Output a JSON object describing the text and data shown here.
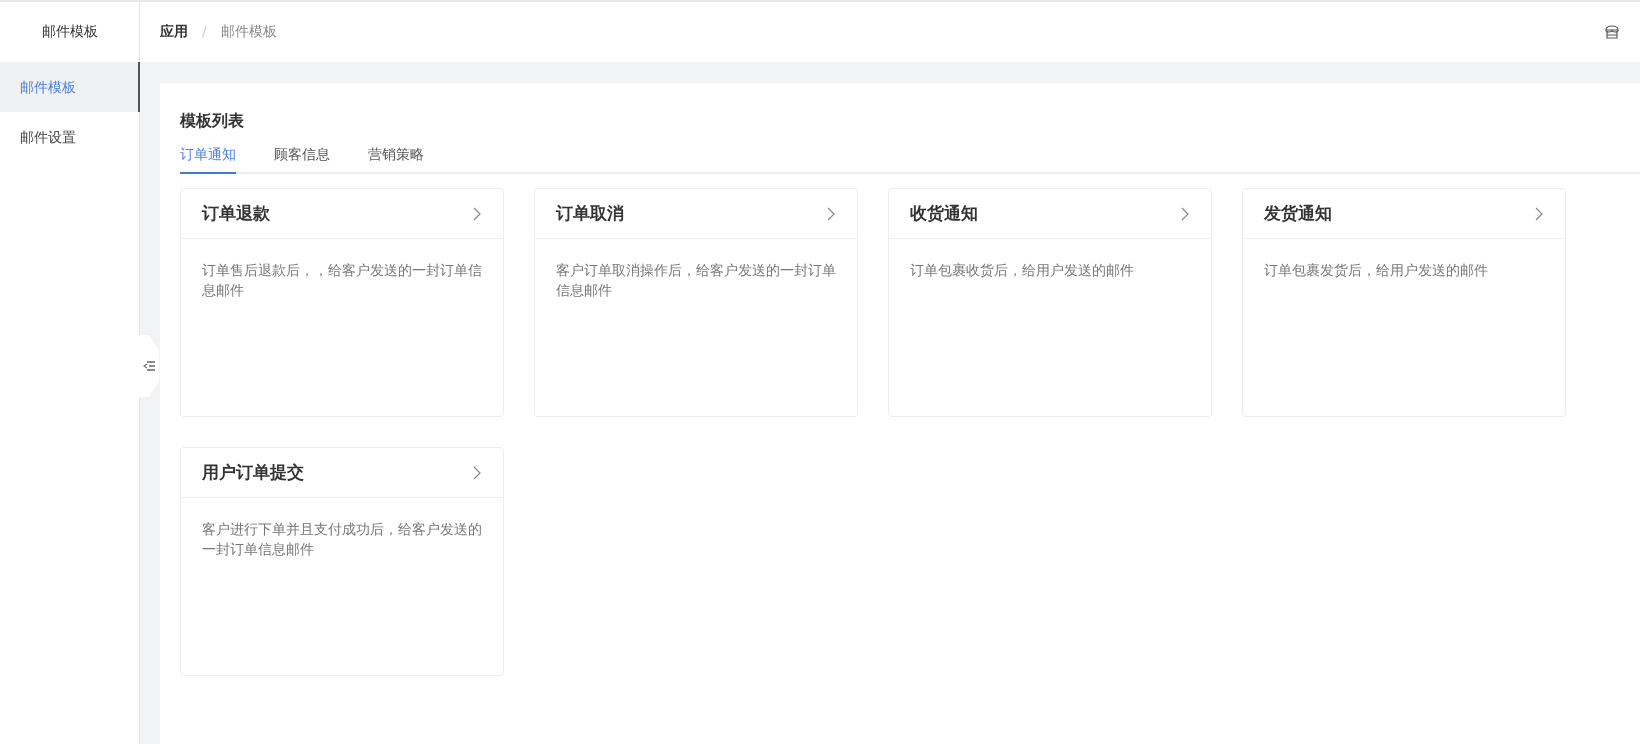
{
  "sidebar": {
    "title": "邮件模板",
    "items": [
      {
        "label": "邮件模板",
        "selected": true
      },
      {
        "label": "邮件设置",
        "selected": false
      }
    ]
  },
  "breadcrumb": [
    "应用",
    "/",
    "邮件模板"
  ],
  "panel": {
    "title": "模板列表",
    "tabs": [
      {
        "label": "订单通知",
        "selected": true
      },
      {
        "label": "顾客信息",
        "selected": false
      },
      {
        "label": "营销策略",
        "selected": false
      }
    ],
    "cards": [
      {
        "title": "订单退款",
        "description": "订单售后退款后，，给客户发送的一封订单信息邮件"
      },
      {
        "title": "订单取消",
        "description": "客户订单取消操作后，给客户发送的一封订单信息邮件"
      },
      {
        "title": "收货通知",
        "description": "订单包裹收货后，给用户发送的邮件"
      },
      {
        "title": "发货通知",
        "description": "订单包裹发货后，给用户发送的邮件"
      },
      {
        "title": "用户订单提交",
        "description": "客户进行下单并且支付成功后，给客户发送的一封订单信息邮件"
      }
    ]
  }
}
